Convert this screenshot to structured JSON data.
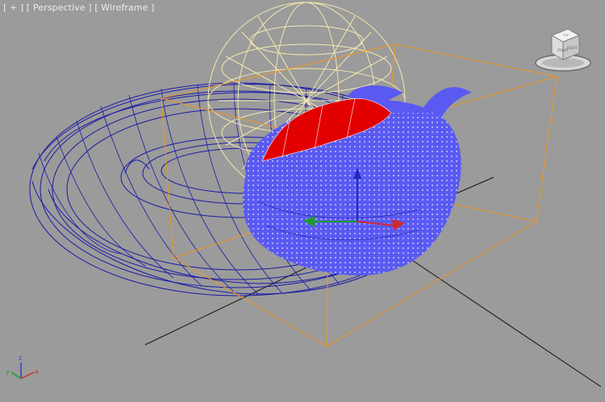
{
  "viewport": {
    "labels": {
      "plus": "[ + ]",
      "view": "[ Perspective ]",
      "mode": "[ Wireframe ]"
    },
    "background": "#9b9b9b"
  },
  "viewcube": {
    "icon": "viewcube-icon",
    "faces": {
      "front": "FRONT",
      "right": "RIGHT",
      "top": "TOP"
    }
  },
  "axis_gizmo": {
    "icon": "world-axis-icon",
    "x_label": "x",
    "y_label": "y",
    "z_label": "z",
    "colors": {
      "x": "#d12a2a",
      "y": "#1d9e2a",
      "z": "#2a45c8"
    }
  },
  "scene_colors": {
    "torus": "#1e1ea8",
    "sphere": "#f5eab0",
    "teapot": "#5b5bf0",
    "selection": "#e10000",
    "bounding_box": "#f0961e",
    "grid_axis": "#111111"
  }
}
